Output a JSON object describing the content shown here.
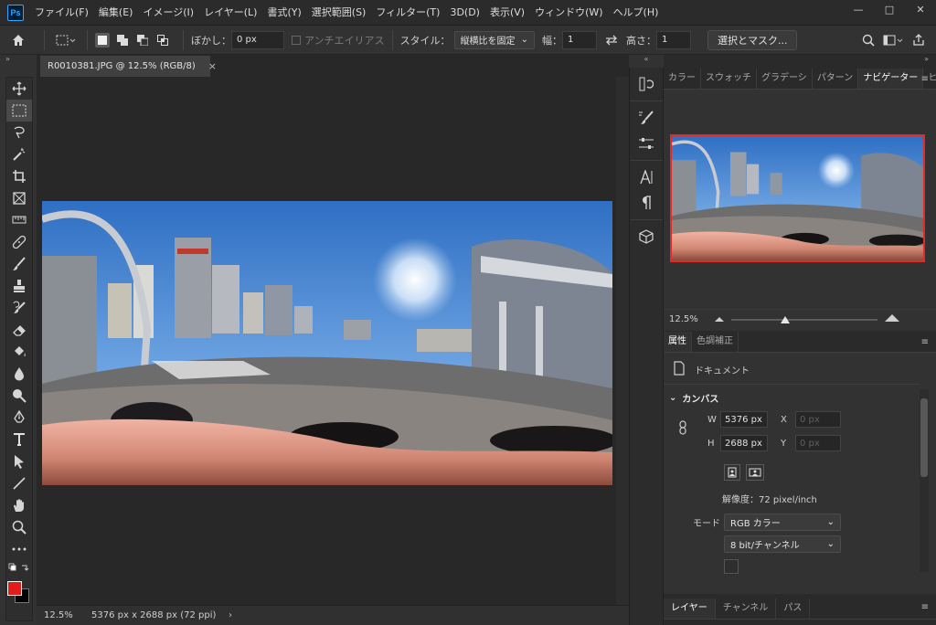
{
  "app": {
    "logo_text": "Ps"
  },
  "menu": [
    "ファイル(F)",
    "編集(E)",
    "イメージ(I)",
    "レイヤー(L)",
    "書式(Y)",
    "選択範囲(S)",
    "フィルター(T)",
    "3D(D)",
    "表示(V)",
    "ウィンドウ(W)",
    "ヘルプ(H)"
  ],
  "window_controls": {
    "minimize": "—",
    "maximize": "□",
    "close": "✕"
  },
  "options": {
    "feather_label": "ぼかし：",
    "feather_value": "0 px",
    "antialias_label": "アンチエイリアス",
    "style_label": "スタイル：",
    "style_value": "縦横比を固定",
    "width_label": "幅：",
    "width_value": "1",
    "height_label": "高さ：",
    "height_value": "1",
    "select_mask_button": "選択とマスク..."
  },
  "document": {
    "tab_title": "R0010381.JPG @ 12.5% (RGB/8)",
    "close_glyph": "×",
    "zoom": "12.5%",
    "status": "5376 px x 2688 px (72 ppi)",
    "status_arrow": "›"
  },
  "panels_top": {
    "tabs": [
      "カラー",
      "スウォッチ",
      "グラデーシ",
      "パターン",
      "ナビゲーター",
      "ヒストグラ"
    ],
    "active_tab": "ナビゲーター",
    "menu_glyph": "≡"
  },
  "navigator": {
    "zoom": "12.5%"
  },
  "properties": {
    "tabs": [
      "属性",
      "色調補正"
    ],
    "active_tab": "属性",
    "doc_label": "ドキュメント",
    "section_title": "カンバス",
    "w_label": "W",
    "w_value": "5376 px",
    "h_label": "H",
    "h_value": "2688 px",
    "x_label": "X",
    "x_placeholder": "0 px",
    "y_label": "Y",
    "y_placeholder": "0 px",
    "resolution": "解像度：72 pixel/inch",
    "mode_label": "モード",
    "mode_value": "RGB カラー",
    "bit_value": "8 bit/チャンネル"
  },
  "layers_panel": {
    "tabs": [
      "レイヤー",
      "チャンネル",
      "パス"
    ],
    "active_tab": "レイヤー"
  },
  "colors": {
    "foreground": "#e21b1b",
    "background": "#000000",
    "accent": "#e02b2b"
  }
}
